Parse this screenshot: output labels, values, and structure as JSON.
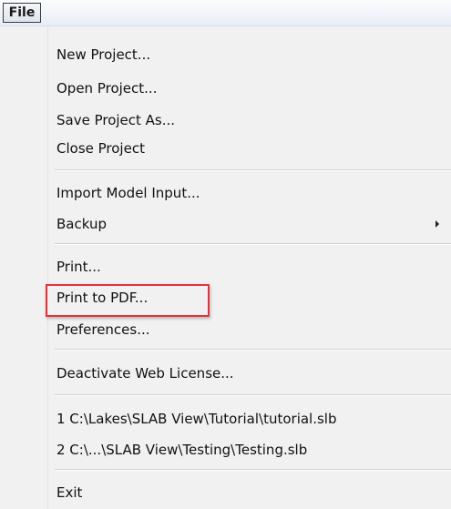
{
  "menubar": {
    "file_label": "File"
  },
  "menu": {
    "items": [
      {
        "label": "New Project..."
      },
      {
        "label": "Open Project..."
      },
      {
        "label": "Save Project As..."
      },
      {
        "label": "Close Project"
      },
      {
        "label": "Import Model Input..."
      },
      {
        "label": "Backup",
        "submenu_icon": "chevron-right-icon"
      },
      {
        "label": "Print..."
      },
      {
        "label": "Print to PDF..."
      },
      {
        "label": "Preferences..."
      },
      {
        "label": "Deactivate Web License..."
      },
      {
        "label": "1 C:\\Lakes\\SLAB View\\Tutorial\\tutorial.slb"
      },
      {
        "label": "2 C:\\...\\SLAB View\\Testing\\Testing.slb"
      },
      {
        "label": "Exit"
      }
    ]
  },
  "colors": {
    "highlight_border": "#e8323a",
    "menu_background": "#f1f1f1"
  }
}
